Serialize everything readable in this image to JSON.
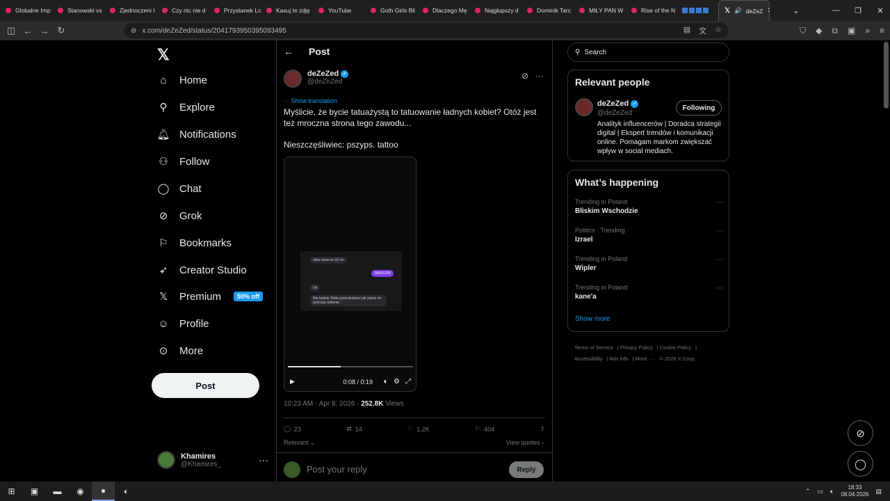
{
  "browser": {
    "tabs": [
      {
        "label": "Globalne Imp"
      },
      {
        "label": "Stanowski vs"
      },
      {
        "label": "Zjednoczeni I"
      },
      {
        "label": "Czy nic nie d"
      },
      {
        "label": "Przystanek Lo"
      },
      {
        "label": "Kasuj te zdję"
      },
      {
        "label": "YouTube"
      },
      {
        "label": "Goth Girls Bli"
      },
      {
        "label": "Dlaczego Mę"
      },
      {
        "label": "Najgłupszy d"
      },
      {
        "label": "Dominik Tarc"
      },
      {
        "label": "MIŁY PAN W"
      },
      {
        "label": "Rise of the N"
      }
    ],
    "active_tab": {
      "label": "deZeZ"
    },
    "url": "x.com/deZeZed/status/2041793950395093495"
  },
  "nav": {
    "items": [
      {
        "label": "Home",
        "icon": "home-icon"
      },
      {
        "label": "Explore",
        "icon": "search-icon"
      },
      {
        "label": "Notifications",
        "icon": "bell-icon"
      },
      {
        "label": "Follow",
        "icon": "person-add-icon"
      },
      {
        "label": "Chat",
        "icon": "chat-icon"
      },
      {
        "label": "Grok",
        "icon": "grok-icon"
      },
      {
        "label": "Bookmarks",
        "icon": "bookmark-icon"
      },
      {
        "label": "Creator Studio",
        "icon": "rocket-icon"
      },
      {
        "label": "Premium",
        "icon": "x-icon"
      },
      {
        "label": "Profile",
        "icon": "person-icon"
      },
      {
        "label": "More",
        "icon": "more-circle-icon"
      }
    ],
    "premium_badge": "50% off",
    "post_button": "Post"
  },
  "account": {
    "name": "Khamires",
    "handle": "@Khamires_"
  },
  "post": {
    "header_title": "Post",
    "author_name": "deZeZed",
    "author_handle": "@deZeZed",
    "show_translation": "Show translation",
    "text_line1": "Myślicie, że bycie tatuażystą to tatuowanie ładnych kobiet? Otóż jest też mroczna strona tego zawodu...",
    "text_line2": "Nieszczęśliwiec: pszyps. tattoo",
    "video": {
      "msg1": "Jaka cena na 18 cm",
      "msg2": "1000/1200",
      "msg3": "Ok",
      "msg4": "Nie będzie Tobie przeszkadzać jak stanie mi podczas robienia",
      "time": "0:08 / 0:19",
      "progress": 0.42
    },
    "timestamp": "10:23 AM · Apr 8, 2026 · ",
    "views_count": "252.8K",
    "views_label": " Views",
    "replies": "23",
    "reposts": "14",
    "likes": "1.2K",
    "bookmarks": "404",
    "relevant": "Relevant ⌄",
    "view_quotes": "View quotes ›",
    "reply_placeholder": "Post your reply",
    "reply_button": "Reply"
  },
  "right": {
    "search_placeholder": "Search",
    "relevant_title": "Relevant people",
    "person_name": "deZeZed",
    "person_handle": "@deZeZed",
    "following": "Following",
    "bio": "Analityk influencerów | Doradca strategii digital | Ekspert trendów i komunikacji online. Pomagam markom zwiększać wpływ w social mediach.",
    "happening_title": "What’s happening",
    "trends": [
      {
        "context": "Trending in Poland",
        "topic": "Bliskim Wschodzie"
      },
      {
        "context": "Politics · Trending",
        "topic": "Izrael"
      },
      {
        "context": "Trending in Poland",
        "topic": "Wipler"
      },
      {
        "context": "Trending in Poland",
        "topic": "kane'a"
      }
    ],
    "show_more": "Show more",
    "footer": [
      "Terms of Service",
      "Privacy Policy",
      "Cookie Policy",
      "Accessibility",
      "Ads info",
      "More ···",
      "© 2026 X Corp."
    ]
  },
  "taskbar": {
    "time": "18:33",
    "date": "08.04.2026"
  }
}
